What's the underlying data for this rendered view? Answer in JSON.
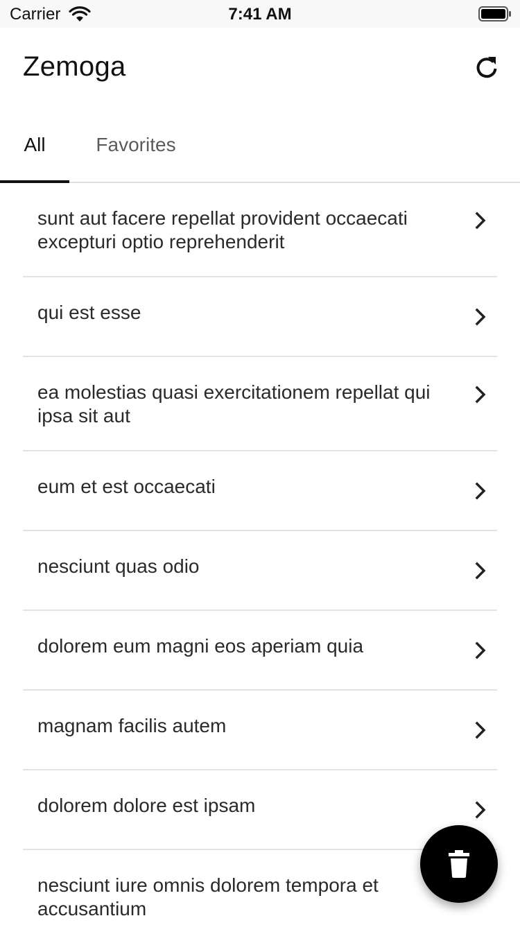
{
  "status_bar": {
    "carrier": "Carrier",
    "time": "7:41 AM"
  },
  "header": {
    "title": "Zemoga",
    "refresh_icon": "refresh-icon"
  },
  "tabs": [
    {
      "label": "All",
      "selected": true
    },
    {
      "label": "Favorites",
      "selected": false
    }
  ],
  "posts": [
    {
      "title": "sunt aut facere repellat provident occaecati excepturi optio reprehenderit"
    },
    {
      "title": "qui est esse"
    },
    {
      "title": "ea molestias quasi exercitationem repellat qui ipsa sit aut"
    },
    {
      "title": "eum et est occaecati"
    },
    {
      "title": "nesciunt quas odio"
    },
    {
      "title": "dolorem eum magni eos aperiam quia"
    },
    {
      "title": "magnam facilis autem"
    },
    {
      "title": "dolorem dolore est ipsam"
    },
    {
      "title": "nesciunt iure omnis dolorem tempora et accusantium"
    }
  ],
  "fab": {
    "icon": "trash-icon"
  },
  "colors": {
    "text": "#111111",
    "tab_inactive": "#5b5b5b",
    "divider": "#e3e3e3",
    "fab": "#000000"
  }
}
